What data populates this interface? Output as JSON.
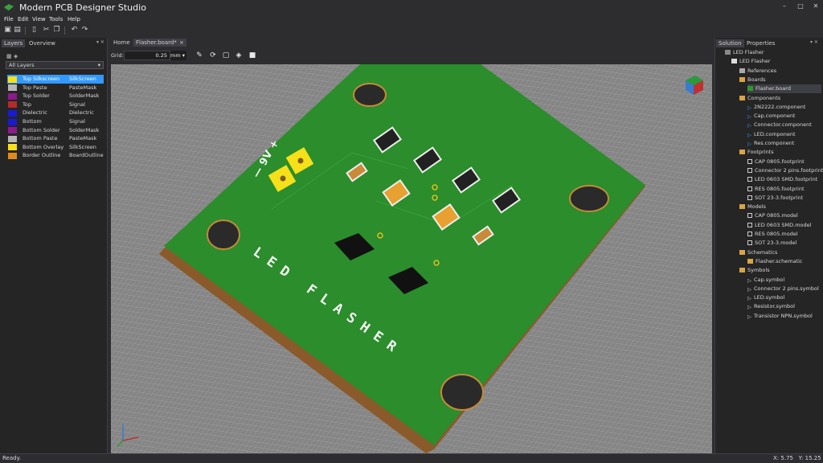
{
  "app": {
    "title": "Modern PCB Designer Studio"
  },
  "menu": [
    "File",
    "Edit",
    "View",
    "Tools",
    "Help"
  ],
  "window_controls": {
    "minimize": "–",
    "maximize": "□",
    "close": "✕"
  },
  "left_panel": {
    "tabs": [
      "Layers",
      "Overview"
    ],
    "filter_value": "All Layers",
    "layers": [
      {
        "name": "Top Silkscreen",
        "type": "SilkScreen",
        "color": "#f5e01a",
        "selected": true
      },
      {
        "name": "Top Paste",
        "type": "PasteMask",
        "color": "#b5b5b5"
      },
      {
        "name": "Top Solder",
        "type": "SolderMask",
        "color": "#8b1a8b"
      },
      {
        "name": "Top",
        "type": "Signal",
        "color": "#b52a2a"
      },
      {
        "name": "Dielectric",
        "type": "Dielectric",
        "color": "#1a1ad1"
      },
      {
        "name": "Bottom",
        "type": "Signal",
        "color": "#1a1ad1"
      },
      {
        "name": "Bottom Solder",
        "type": "SolderMask",
        "color": "#8b1a8b"
      },
      {
        "name": "Bottom Paste",
        "type": "PasteMask",
        "color": "#b5b5b5"
      },
      {
        "name": "Bottom Overlay",
        "type": "SilkScreen",
        "color": "#f5e01a"
      },
      {
        "name": "Border Outline",
        "type": "BoardOutline",
        "color": "#e08a1a"
      }
    ]
  },
  "doc_tabs": [
    {
      "label": "Home"
    },
    {
      "label": "Flasher.board*",
      "close": "×",
      "active": true
    }
  ],
  "view_toolbar": {
    "grid_label": "Grid:",
    "grid_value": "0.25",
    "unit": "mm"
  },
  "board": {
    "silkscreen_text": "LED FLASHER",
    "voltage_label": "— 9V +",
    "board_color": "#2a8a2a",
    "edge_color": "#8a5a2a"
  },
  "right_panel": {
    "tabs": [
      "Solution",
      "Properties"
    ],
    "tree": [
      {
        "label": "LED Flasher",
        "level": 0,
        "icon": "solution"
      },
      {
        "label": "LED Flasher",
        "level": 1,
        "icon": "project"
      },
      {
        "label": "References",
        "level": 2,
        "icon": "refs"
      },
      {
        "label": "Boards",
        "level": 2,
        "icon": "folder"
      },
      {
        "label": "Flasher.board",
        "level": 3,
        "icon": "board",
        "selected": true
      },
      {
        "label": "Components",
        "level": 2,
        "icon": "folder"
      },
      {
        "label": "2N2222.component",
        "level": 3,
        "icon": "component"
      },
      {
        "label": "Cap.component",
        "level": 3,
        "icon": "component"
      },
      {
        "label": "Connector.component",
        "level": 3,
        "icon": "component"
      },
      {
        "label": "LED.component",
        "level": 3,
        "icon": "component"
      },
      {
        "label": "Res.component",
        "level": 3,
        "icon": "component"
      },
      {
        "label": "Footprints",
        "level": 2,
        "icon": "folder"
      },
      {
        "label": "CAP 0805.footprint",
        "level": 3,
        "icon": "footprint"
      },
      {
        "label": "Connector 2 pins.footprint",
        "level": 3,
        "icon": "footprint"
      },
      {
        "label": "LED 0603 SMD.footprint",
        "level": 3,
        "icon": "footprint"
      },
      {
        "label": "RES 0805.footprint",
        "level": 3,
        "icon": "footprint"
      },
      {
        "label": "SOT 23-3.footprint",
        "level": 3,
        "icon": "footprint"
      },
      {
        "label": "Models",
        "level": 2,
        "icon": "folder"
      },
      {
        "label": "CAP 0805.model",
        "level": 3,
        "icon": "model"
      },
      {
        "label": "LED 0603 SMD.model",
        "level": 3,
        "icon": "model"
      },
      {
        "label": "RES 0805.model",
        "level": 3,
        "icon": "model"
      },
      {
        "label": "SOT 23-3.model",
        "level": 3,
        "icon": "model"
      },
      {
        "label": "Schematics",
        "level": 2,
        "icon": "folder"
      },
      {
        "label": "Flasher.schematic",
        "level": 3,
        "icon": "schematic"
      },
      {
        "label": "Symbols",
        "level": 2,
        "icon": "folder"
      },
      {
        "label": "Cap.symbol",
        "level": 3,
        "icon": "symbol"
      },
      {
        "label": "Connector 2 pins.symbol",
        "level": 3,
        "icon": "symbol"
      },
      {
        "label": "LED.symbol",
        "level": 3,
        "icon": "symbol"
      },
      {
        "label": "Resistor.symbol",
        "level": 3,
        "icon": "symbol"
      },
      {
        "label": "Transistor NPN.symbol",
        "level": 3,
        "icon": "symbol"
      }
    ]
  },
  "status": {
    "text": "Ready.",
    "x_label": "X:",
    "x_value": "5.75",
    "y_label": "Y:",
    "y_value": "15.25"
  }
}
